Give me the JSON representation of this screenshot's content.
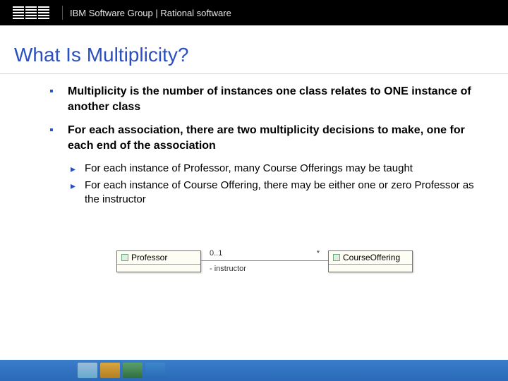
{
  "header": {
    "brand": "IBM",
    "text": "IBM Software Group | Rational software"
  },
  "title": "What Is Multiplicity?",
  "bullets": [
    {
      "text": "Multiplicity is the number of instances one class relates to ONE instance of another class",
      "sub": []
    },
    {
      "text": "For each association, there are two multiplicity decisions to make, one for each end of the association",
      "sub": [
        "For each instance of Professor, many Course Offerings may be taught",
        "For each instance of Course Offering, there may be either one or zero Professor as the instructor"
      ]
    }
  ],
  "diagram": {
    "left_class": "Professor",
    "right_class": "CourseOffering",
    "left_multiplicity": "0..1",
    "right_multiplicity": "*",
    "role": "- instructor"
  }
}
